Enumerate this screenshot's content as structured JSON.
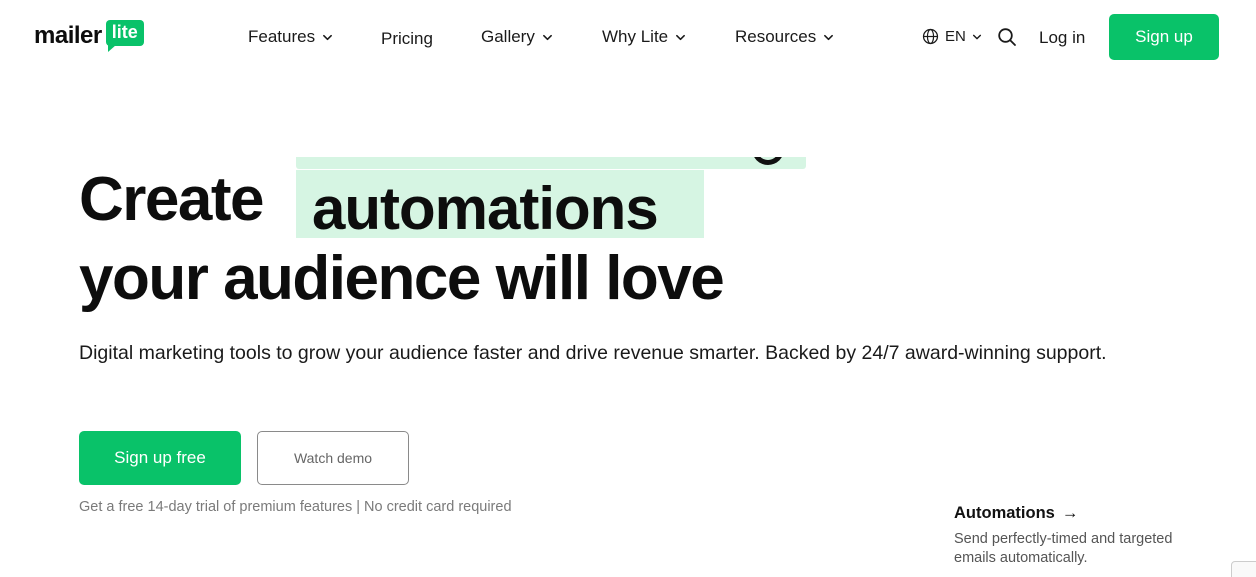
{
  "header": {
    "logo": {
      "word": "mailer",
      "bubble": "lite"
    },
    "nav": [
      {
        "label": "Features",
        "dropdown": true
      },
      {
        "label": "Pricing",
        "dropdown": false
      },
      {
        "label": "Gallery",
        "dropdown": true
      },
      {
        "label": "Why Lite",
        "dropdown": true
      },
      {
        "label": "Resources",
        "dropdown": true
      }
    ],
    "language": "EN",
    "login_label": "Log in",
    "signup_label": "Sign up"
  },
  "hero": {
    "headline_prefix": "Create",
    "headline_highlight": "automations",
    "headline_line2": "your audience will love",
    "subhead": "Digital marketing tools to grow your audience faster and drive revenue smarter. Backed by 24/7 award-winning support.",
    "cta_primary": "Sign up free",
    "cta_secondary": "Watch demo",
    "trial_note": "Get a free 14-day trial of premium features | No credit card required"
  },
  "feature_card": {
    "title": "Automations",
    "arrow": "→",
    "description": "Send perfectly-timed and targeted emails automatically."
  },
  "colors": {
    "brand_green": "#09c269",
    "highlight_mint": "#d6f5e3",
    "text_dark": "#0d0d0d",
    "text_muted": "#7a7a7a"
  },
  "icons": [
    "globe-icon",
    "chevron-down-icon",
    "search-icon",
    "arrow-right-icon"
  ]
}
